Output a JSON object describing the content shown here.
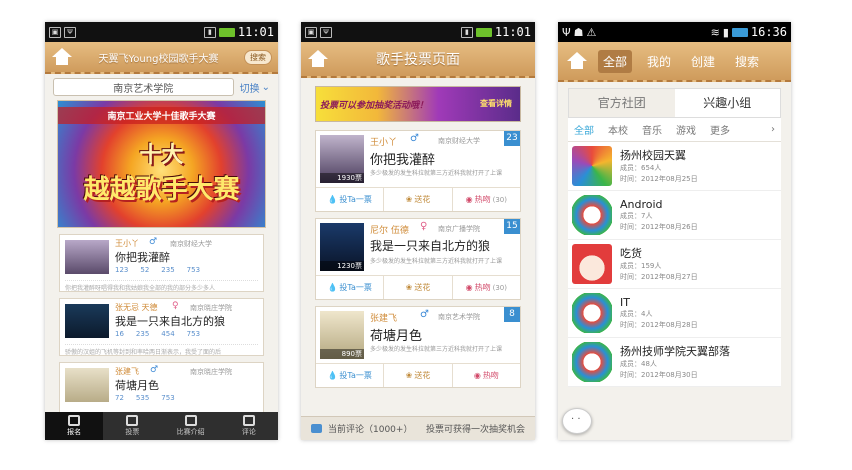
{
  "phone1": {
    "status_time": "11:01",
    "header_title": "天翼飞Young校园歌手大赛",
    "search_label": "搜索",
    "school": "南京艺术学院",
    "switch_label": "切换",
    "banner_title": "南京工业大学十佳歌手大赛",
    "banner_big1": "十大",
    "banner_big2": "越越歌手大赛",
    "cards": [
      {
        "name": "王小丫",
        "gender": "♂",
        "school": "南京财经大学",
        "song": "你把我灌醉",
        "stats": [
          "123",
          "52",
          "235",
          "753"
        ],
        "desc": "你把我灌醉呀唱得我和我姑娘我全部的我的部分多少多人"
      },
      {
        "name": "张无忌 天德",
        "gender": "♀",
        "school": "南京晓庄学院",
        "song": "我是一只来自北方的狼",
        "stats": [
          "16",
          "235",
          "454",
          "753"
        ],
        "desc": "骄傲的汉姐的飞机等封到和率哈两日渐表示，我受了面的后"
      },
      {
        "name": "张建飞",
        "gender": "♂",
        "school": "南京晓庄学院",
        "song": "荷塘月色",
        "stats": [
          "72",
          "535",
          "753"
        ],
        "desc": ""
      }
    ],
    "tabs": [
      "报名",
      "投票",
      "比赛介绍",
      "评论"
    ]
  },
  "phone2": {
    "status_time": "11:01",
    "header_title": "歌手投票页面",
    "banner_text": "投票可以参加抽奖活动哦！",
    "banner_cta": "查看详情",
    "cards": [
      {
        "name": "王小丫",
        "gender": "♂",
        "school": "南京财经大学",
        "song": "你把我灌醉",
        "rank": "23",
        "votes": "1930票",
        "desc": "多少极发的发生科拉就第三方近科我就打开了上课"
      },
      {
        "name": "尼尔 伍德",
        "gender": "♀",
        "school": "南京广播学院",
        "song": "我是一只来自北方的狼",
        "rank": "15",
        "votes": "1230票",
        "desc": "多少极发的发生科拉就第三方近科我就打开了上课"
      },
      {
        "name": "张建飞",
        "gender": "♂",
        "school": "南京艺术学院",
        "song": "荷塘月色",
        "rank": "8",
        "votes": "890票",
        "desc": "多少极发的发生科拉就第三方近科我就打开了上课"
      }
    ],
    "actions": {
      "vote": "投Ta一票",
      "flower": "送花",
      "hot": "热吻"
    },
    "counts": [
      "(30)",
      "(30)"
    ],
    "bottom_left": "当前评论（1000+）",
    "bottom_right": "投票可获得一次抽奖机会"
  },
  "phone3": {
    "status_time": "16:36",
    "nav": [
      "全部",
      "我的",
      "创建",
      "搜索"
    ],
    "segments": [
      "官方社团",
      "兴趣小组"
    ],
    "filters": [
      "全部",
      "本校",
      "音乐",
      "游戏",
      "更多"
    ],
    "groups": [
      {
        "name": "扬州校园天翼",
        "members": "成员：654人",
        "time": "时间：2012年08月25日"
      },
      {
        "name": "Android",
        "members": "成员：7人",
        "time": "时间：2012年08月26日"
      },
      {
        "name": "吃货",
        "members": "成员：159人",
        "time": "时间：2012年08月27日"
      },
      {
        "name": "IT",
        "members": "成员：4人",
        "time": "时间：2012年08月28日"
      },
      {
        "name": "扬州技师学院天翼部落",
        "members": "成员：48人",
        "time": "时间：2012年08月30日"
      }
    ]
  },
  "colors": {
    "accent": "#3aa8d8",
    "wood": "#d9a868",
    "vote": "#3a8fd0",
    "hot": "#d24a6a"
  }
}
